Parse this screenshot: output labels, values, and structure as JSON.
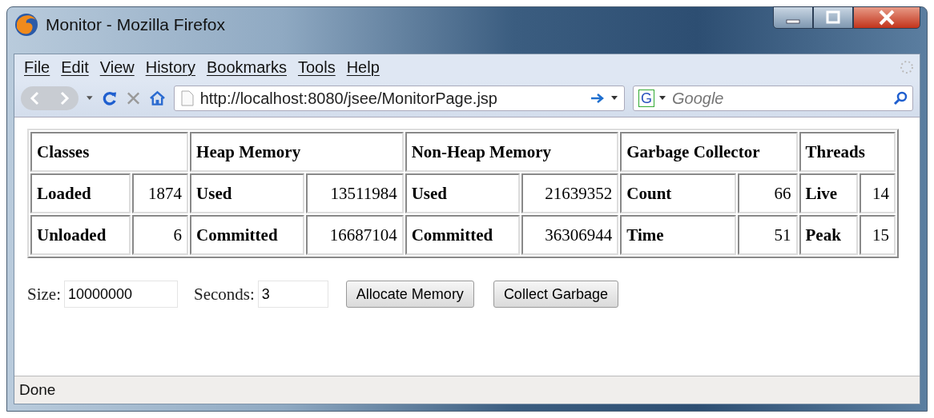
{
  "window": {
    "title": "Monitor - Mozilla Firefox"
  },
  "menu": [
    "File",
    "Edit",
    "View",
    "History",
    "Bookmarks",
    "Tools",
    "Help"
  ],
  "navbar": {
    "url": "http://localhost:8080/jsee/MonitorPage.jsp",
    "search_engine": "G",
    "search_placeholder": "Google"
  },
  "table": {
    "groups": [
      {
        "title": "Classes",
        "rows": [
          {
            "label": "Loaded",
            "value": "1874"
          },
          {
            "label": "Unloaded",
            "value": "6"
          }
        ]
      },
      {
        "title": "Heap Memory",
        "rows": [
          {
            "label": "Used",
            "value": "13511984"
          },
          {
            "label": "Committed",
            "value": "16687104"
          }
        ]
      },
      {
        "title": "Non-Heap Memory",
        "rows": [
          {
            "label": "Used",
            "value": "21639352"
          },
          {
            "label": "Committed",
            "value": "36306944"
          }
        ]
      },
      {
        "title": "Garbage Collector",
        "rows": [
          {
            "label": "Count",
            "value": "66"
          },
          {
            "label": "Time",
            "value": "51"
          }
        ]
      },
      {
        "title": "Threads",
        "rows": [
          {
            "label": "Live",
            "value": "14"
          },
          {
            "label": "Peak",
            "value": "15"
          }
        ]
      }
    ]
  },
  "form": {
    "fields": [
      {
        "label": "Size:",
        "value": "10000000"
      },
      {
        "label": "Seconds:",
        "value": "3"
      }
    ],
    "buttons": [
      "Allocate Memory",
      "Collect Garbage"
    ]
  },
  "status_bar": "Done"
}
